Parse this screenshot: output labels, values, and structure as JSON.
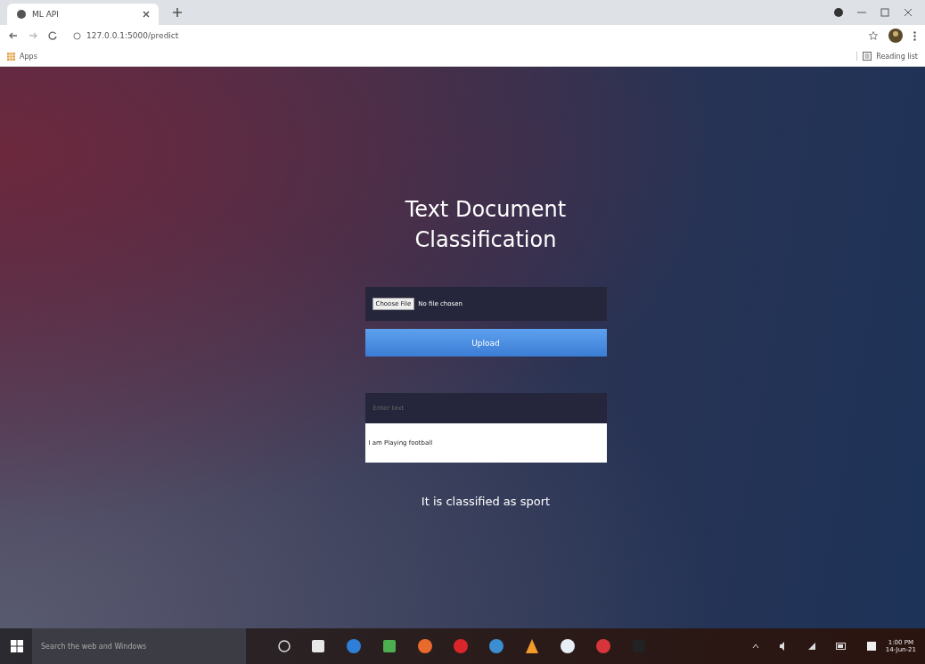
{
  "browser": {
    "tab_title": "ML API",
    "url": "127.0.0.1:5000/predict",
    "bookmarks": [
      {
        "label": "Apps"
      }
    ],
    "reading_list": "Reading list"
  },
  "page": {
    "title": [
      "Text Document",
      "Classification"
    ],
    "file_input": {
      "button": "Choose File",
      "status": "No file chosen"
    },
    "upload_button": "Upload",
    "text_input": {
      "placeholder": "Enter text"
    },
    "text_area": {
      "value": "I am Playing football"
    },
    "result": "It is classified as sport"
  },
  "taskbar": {
    "search": {
      "placeholder": "Search the web and Windows"
    },
    "time": "1:00 PM",
    "date": "14-Jun-21"
  }
}
